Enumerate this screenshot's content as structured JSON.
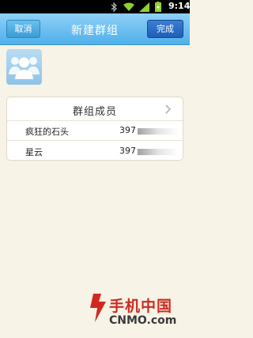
{
  "status_bar": {
    "time": "9:14"
  },
  "header": {
    "title": "新建群组",
    "cancel_label": "取消",
    "done_label": "完成"
  },
  "group": {
    "avatar_icon": "group-avatar-icon"
  },
  "members": {
    "header": "群组成员",
    "rows": [
      {
        "name": "疯狂的石头",
        "phone": "397"
      },
      {
        "name": "星云",
        "phone": "397"
      }
    ]
  },
  "watermark": {
    "cn": "手机中国",
    "en": "CNMO.com"
  },
  "colors": {
    "titlebar": "#4fb0ea",
    "done_button": "#1f5fb7",
    "background": "#f7f3e6",
    "watermark_red": "#d02a20"
  }
}
